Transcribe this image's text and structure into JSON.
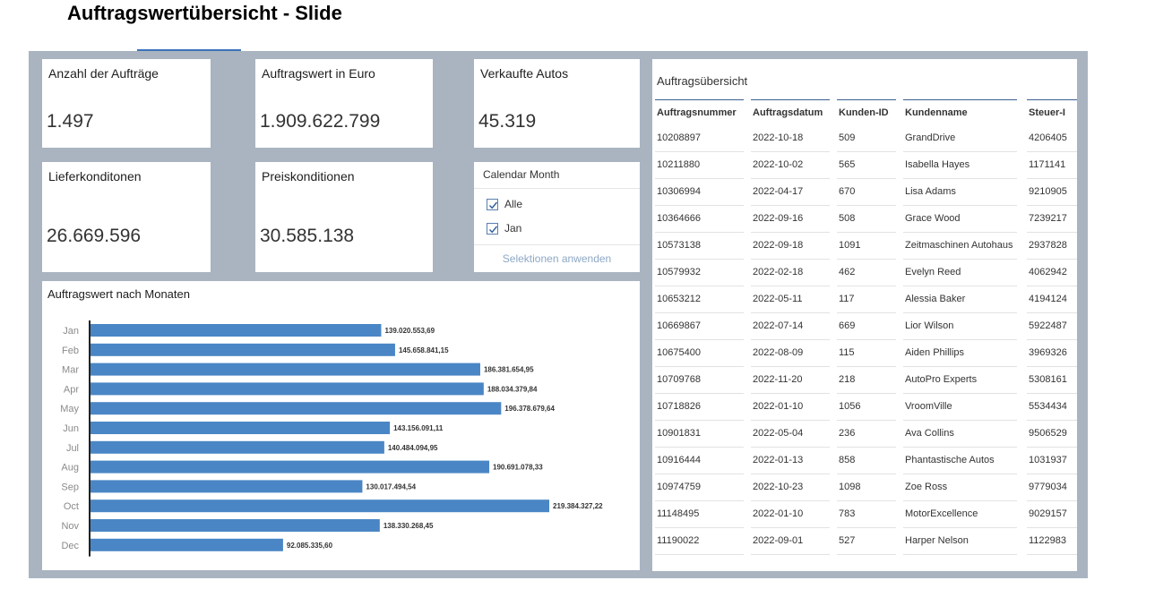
{
  "page": {
    "title": "Auftragswertübersicht - Slide"
  },
  "kpis": {
    "orders": {
      "label": "Anzahl der Aufträge",
      "value": "1.497"
    },
    "order_value": {
      "label": "Auftragswert in Euro",
      "value": "1.909.622.799"
    },
    "cars_sold": {
      "label": "Verkaufte Autos",
      "value": "45.319"
    },
    "delivery": {
      "label": "Lieferkonditonen",
      "value": "26.669.596"
    },
    "price": {
      "label": "Preiskonditionen",
      "value": "30.585.138"
    }
  },
  "filter": {
    "title": "Calendar Month",
    "options": [
      {
        "label": "Alle",
        "checked": true
      },
      {
        "label": "Jan",
        "checked": true
      }
    ],
    "apply_label": "Selektionen anwenden"
  },
  "chart": {
    "title": "Auftragswert nach Monaten",
    "bar_color": "#4a86c5"
  },
  "chart_data": {
    "type": "bar",
    "orientation": "horizontal",
    "title": "Auftragswert nach Monaten",
    "xlabel": "",
    "ylabel": "",
    "categories": [
      "Jan",
      "Feb",
      "Mar",
      "Apr",
      "May",
      "Jun",
      "Jul",
      "Aug",
      "Sep",
      "Oct",
      "Nov",
      "Dec"
    ],
    "values": [
      139020553.69,
      145658841.15,
      186381654.95,
      188034379.84,
      196378679.64,
      143156091.11,
      140484094.95,
      190691078.33,
      130017494.54,
      219384327.22,
      138330268.45,
      92085335.6
    ],
    "labels": [
      "139.020.553,69",
      "145.658.841,15",
      "186.381.654,95",
      "188.034.379,84",
      "196.378.679,64",
      "143.156.091,11",
      "140.484.094,95",
      "190.691.078,33",
      "130.017.494,54",
      "219.384.327,22",
      "138.330.268,45",
      "92.085.335,60"
    ],
    "grid": false
  },
  "table": {
    "title": "Auftragsübersicht",
    "columns": [
      "Auftragsnummer",
      "Auftragsdatum",
      "Kunden-ID",
      "Kundenname",
      "Steuer-I"
    ],
    "rows": [
      [
        "10208897",
        "2022-10-18",
        "509",
        "GrandDrive",
        "4206405"
      ],
      [
        "10211880",
        "2022-10-02",
        "565",
        "Isabella Hayes",
        "1171141"
      ],
      [
        "10306994",
        "2022-04-17",
        "670",
        "Lisa Adams",
        "9210905"
      ],
      [
        "10364666",
        "2022-09-16",
        "508",
        "Grace Wood",
        "7239217"
      ],
      [
        "10573138",
        "2022-09-18",
        "1091",
        "Zeitmaschinen Autohaus",
        "2937828"
      ],
      [
        "10579932",
        "2022-02-18",
        "462",
        "Evelyn Reed",
        "4062942"
      ],
      [
        "10653212",
        "2022-05-11",
        "117",
        "Alessia Baker",
        "4194124"
      ],
      [
        "10669867",
        "2022-07-14",
        "669",
        "Lior Wilson",
        "5922487"
      ],
      [
        "10675400",
        "2022-08-09",
        "115",
        "Aiden Phillips",
        "3969326"
      ],
      [
        "10709768",
        "2022-11-20",
        "218",
        "AutoPro Experts",
        "5308161"
      ],
      [
        "10718826",
        "2022-01-10",
        "1056",
        "VroomVille",
        "5534434"
      ],
      [
        "10901831",
        "2022-05-04",
        "236",
        "Ava Collins",
        "9506529"
      ],
      [
        "10916444",
        "2022-01-13",
        "858",
        "Phantastische Autos",
        "1031937"
      ],
      [
        "10974759",
        "2022-10-23",
        "1098",
        "Zoe Ross",
        "9779034"
      ],
      [
        "11148495",
        "2022-01-10",
        "783",
        "MotorExcellence",
        "9029157"
      ],
      [
        "11190022",
        "2022-09-01",
        "527",
        "Harper Nelson",
        "1122983"
      ]
    ]
  }
}
